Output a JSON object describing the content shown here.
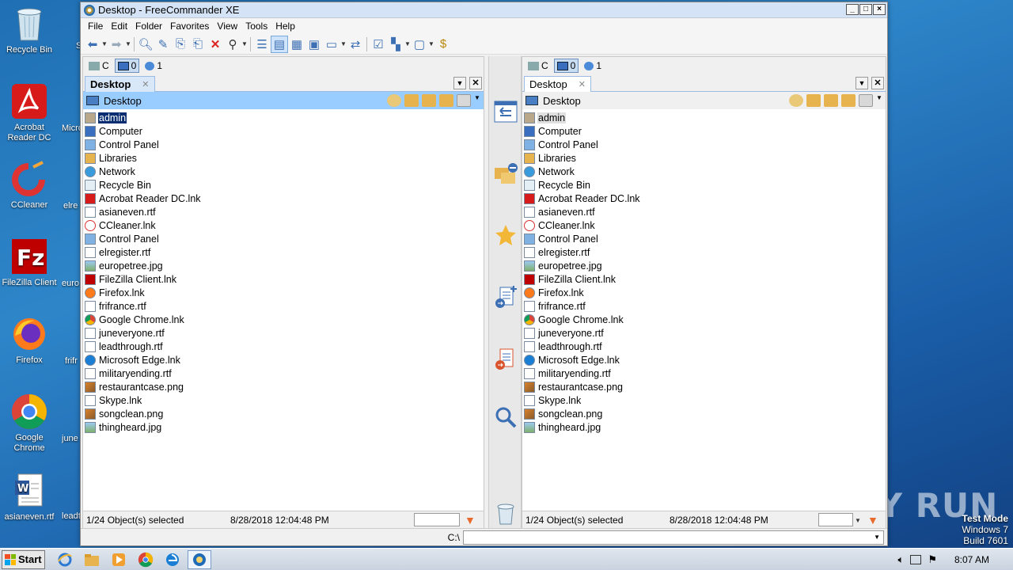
{
  "desktop": {
    "icons": [
      {
        "label": "Recycle Bin",
        "icon": "recycle-bin-icon"
      },
      {
        "label": "Acrobat Reader DC",
        "icon": "acrobat-icon"
      },
      {
        "label": "CCleaner",
        "icon": "ccleaner-icon"
      },
      {
        "label": "FileZilla Client",
        "icon": "filezilla-icon"
      },
      {
        "label": "Firefox",
        "icon": "firefox-icon"
      },
      {
        "label": "Google Chrome",
        "icon": "chrome-icon"
      },
      {
        "label": "asianeven.rtf",
        "icon": "word-doc-icon"
      }
    ],
    "partial_labels": [
      "S",
      "Micro",
      "elre",
      "euro",
      "frifr",
      "june",
      "leadt"
    ]
  },
  "window": {
    "title": "Desktop - FreeCommander XE",
    "controls": [
      "_",
      "□",
      "×"
    ]
  },
  "menu": [
    "File",
    "Edit",
    "Folder",
    "Favorites",
    "View",
    "Tools",
    "Help"
  ],
  "left_panel": {
    "drives": [
      "C",
      "0",
      "1"
    ],
    "tab_label": "Desktop",
    "path": "Desktop",
    "selected_index": 0,
    "status_count": "1/24 Object(s) selected",
    "status_date": "8/28/2018 12:04:48 PM"
  },
  "right_panel": {
    "drives": [
      "C",
      "0",
      "1"
    ],
    "tab_label": "Desktop",
    "path": "Desktop",
    "selected_index": 0,
    "status_count": "1/24 Object(s) selected",
    "status_date": "8/28/2018 12:04:48 PM"
  },
  "files": [
    {
      "name": "admin",
      "type": "user"
    },
    {
      "name": "Computer",
      "type": "computer"
    },
    {
      "name": "Control Panel",
      "type": "control"
    },
    {
      "name": "Libraries",
      "type": "library"
    },
    {
      "name": "Network",
      "type": "network"
    },
    {
      "name": "Recycle Bin",
      "type": "recycle"
    },
    {
      "name": "Acrobat Reader DC.lnk",
      "type": "acrobat"
    },
    {
      "name": "asianeven.rtf",
      "type": "rtf"
    },
    {
      "name": "CCleaner.lnk",
      "type": "ccleaner"
    },
    {
      "name": "Control Panel",
      "type": "control"
    },
    {
      "name": "elregister.rtf",
      "type": "rtf"
    },
    {
      "name": "europetree.jpg",
      "type": "jpg"
    },
    {
      "name": "FileZilla Client.lnk",
      "type": "filezilla"
    },
    {
      "name": "Firefox.lnk",
      "type": "firefox"
    },
    {
      "name": "frifrance.rtf",
      "type": "rtf"
    },
    {
      "name": "Google Chrome.lnk",
      "type": "chrome"
    },
    {
      "name": "juneveryone.rtf",
      "type": "rtf"
    },
    {
      "name": "leadthrough.rtf",
      "type": "rtf"
    },
    {
      "name": "Microsoft Edge.lnk",
      "type": "edge"
    },
    {
      "name": "militaryending.rtf",
      "type": "rtf"
    },
    {
      "name": "restaurantcase.png",
      "type": "png"
    },
    {
      "name": "Skype.lnk",
      "type": "blank"
    },
    {
      "name": "songclean.png",
      "type": "png"
    },
    {
      "name": "thingheard.jpg",
      "type": "jpg"
    }
  ],
  "command_line": {
    "label": "C:\\",
    "value": ""
  },
  "taskbar": {
    "start_label": "Start",
    "clock": "8:07 AM"
  },
  "watermark": "ANY RUN",
  "os_info": {
    "line1": "Test Mode",
    "line2": "Windows 7",
    "line3": "Build 7601"
  },
  "colors": {
    "selection": "#0b2e73",
    "active_path": "#99ccff",
    "accent": "#3c6fb4"
  }
}
